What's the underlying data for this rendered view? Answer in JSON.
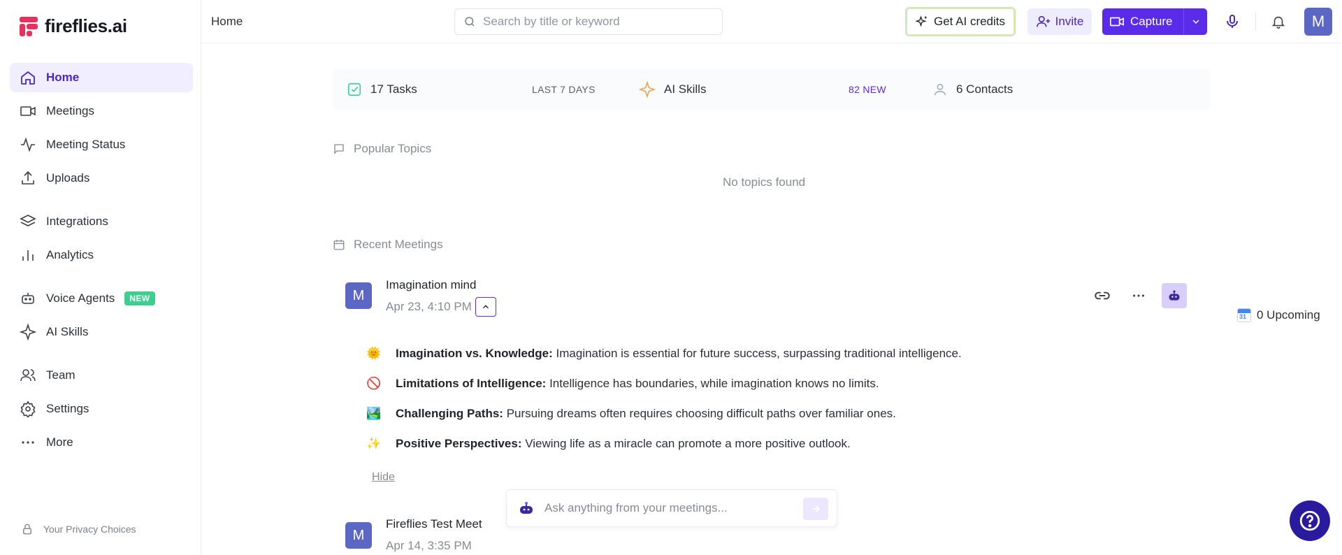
{
  "brand": {
    "name": "fireflies.ai"
  },
  "sidebar": {
    "items": [
      {
        "label": "Home"
      },
      {
        "label": "Meetings"
      },
      {
        "label": "Meeting Status"
      },
      {
        "label": "Uploads"
      },
      {
        "label": "Integrations"
      },
      {
        "label": "Analytics"
      },
      {
        "label": "Voice Agents",
        "badge": "NEW"
      },
      {
        "label": "AI Skills"
      },
      {
        "label": "Team"
      },
      {
        "label": "Settings"
      },
      {
        "label": "More"
      }
    ],
    "privacy": "Your Privacy Choices"
  },
  "header": {
    "breadcrumb": "Home",
    "search_placeholder": "Search by title or keyword",
    "credits_label": "Get AI credits",
    "invite_label": "Invite",
    "capture_label": "Capture",
    "avatar_initial": "M"
  },
  "stats": {
    "tasks": {
      "label": "17 Tasks",
      "meta": "LAST 7 DAYS"
    },
    "skills": {
      "label": "AI Skills",
      "meta": "82 NEW"
    },
    "contacts": {
      "label": "6 Contacts"
    }
  },
  "popular_topics": {
    "heading": "Popular Topics",
    "empty": "No topics found"
  },
  "recent_meetings": {
    "heading": "Recent Meetings",
    "meetings": [
      {
        "initial": "M",
        "title": "Imagination mind",
        "date": "Apr 23, 4:10 PM",
        "summary": [
          {
            "emoji": "🌞",
            "title": "Imagination vs. Knowledge:",
            "text": " Imagination is essential for future success, surpassing traditional intelligence."
          },
          {
            "emoji": "🚫",
            "title": "Limitations of Intelligence:",
            "text": " Intelligence has boundaries, while imagination knows no limits."
          },
          {
            "emoji": "🏞️",
            "title": "Challenging Paths:",
            "text": " Pursuing dreams often requires choosing difficult paths over familiar ones."
          },
          {
            "emoji": "✨",
            "title": "Positive Perspectives:",
            "text": " Viewing life as a miracle can promote a more positive outlook."
          }
        ],
        "hide_label": "Hide"
      },
      {
        "initial": "M",
        "title": "Fireflies Test Meet",
        "date": "Apr 14, 3:35 PM"
      }
    ]
  },
  "upcoming": {
    "label": "0 Upcoming",
    "cal_day": "31"
  },
  "ask": {
    "placeholder": "Ask anything from your meetings..."
  },
  "colors": {
    "accent": "#5a2be8",
    "active_bg": "#f1efff",
    "badge_new": "#3ccf8e",
    "avatar": "#5c66c5"
  }
}
